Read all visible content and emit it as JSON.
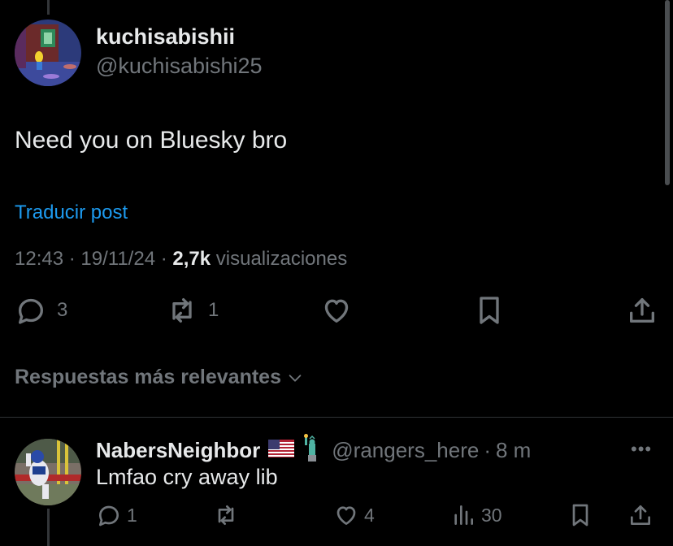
{
  "post": {
    "author_name": "kuchisabishii",
    "author_handle": "@kuchisabishi25",
    "text": "Need you on Bluesky bro",
    "translate_label": "Traducir post",
    "time": "12:43",
    "date": "19/11/24",
    "separator": "·",
    "views_count": "2,7k",
    "views_label": "visualizaciones",
    "actions": {
      "reply_count": "3",
      "repost_count": "1"
    }
  },
  "sort": {
    "label": "Respuestas más relevantes",
    "icon": "chevron-down-icon"
  },
  "reply": {
    "name": "NabersNeighbor",
    "emoji_flag": "🇺🇸",
    "emoji_statue": "🗽",
    "handle": "@rangers_here",
    "separator": "·",
    "time": "8 m",
    "more": "•••",
    "text": "Lmfao cry away lib",
    "actions": {
      "reply_count": "1",
      "repost_count": "",
      "like_count": "4",
      "views_count": "30"
    }
  },
  "colors": {
    "background": "#000000",
    "primary_text": "#e7e9ea",
    "secondary_text": "#71767b",
    "link": "#1d9bf0",
    "divider": "#2f3336"
  }
}
